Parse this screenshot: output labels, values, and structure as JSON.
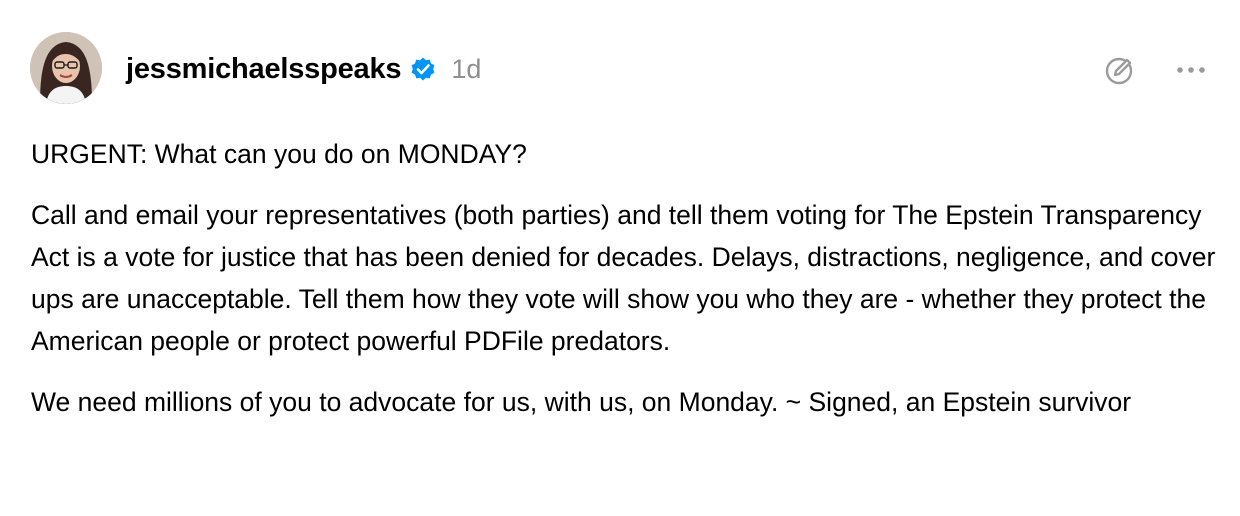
{
  "post": {
    "author": {
      "username": "jessmichaelsspeaks",
      "verified": true,
      "avatar_icon": "profile-photo"
    },
    "timestamp": "1d",
    "actions": {
      "edit_icon": "pen-circle-icon",
      "more_icon": "ellipsis-icon"
    },
    "paragraphs": [
      "URGENT: What can you do on MONDAY?",
      "Call and email your representatives (both parties) and tell them voting for The Epstein Transparency Act is a vote for justice that has been denied for decades. Delays, distractions, negligence, and cover ups are unacceptable. Tell them how they vote will show you who they are - whether they protect the American people or protect powerful PDFile predators.",
      "We need millions of you to advocate for us, with us, on Monday. ~ Signed, an Epstein survivor"
    ]
  },
  "colors": {
    "verified_badge": "#0095f6",
    "timestamp": "#8e8e8e",
    "icon_gray": "#9b9b9b",
    "text": "#000000"
  }
}
